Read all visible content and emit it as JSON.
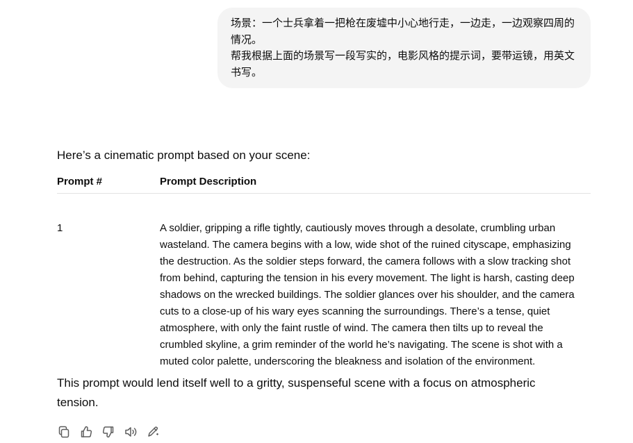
{
  "user_message": {
    "line1": "场景：一个士兵拿着一把枪在废墟中小心地行走，一边走，一边观察四周的情况。",
    "line2": "帮我根据上面的场景写一段写实的，电影风格的提示词，要带运镜，用英文书写。"
  },
  "assistant": {
    "intro": "Here’s a cinematic prompt based on your scene:",
    "table": {
      "headers": [
        "Prompt #",
        "Prompt Description"
      ],
      "rows": [
        {
          "number": "1",
          "description": "A soldier, gripping a rifle tightly, cautiously moves through a desolate, crumbling urban wasteland. The camera begins with a low, wide shot of the ruined cityscape, emphasizing the destruction. As the soldier steps forward, the camera follows with a slow tracking shot from behind, capturing the tension in his every movement. The light is harsh, casting deep shadows on the wrecked buildings. The soldier glances over his shoulder, and the camera cuts to a close-up of his wary eyes scanning the surroundings. There’s a tense, quiet atmosphere, with only the faint rustle of wind. The camera then tilts up to reveal the crumbled skyline, a grim reminder of the world he’s navigating. The scene is shot with a muted color palette, underscoring the bleakness and isolation of the environment."
        }
      ]
    },
    "outro": "This prompt would lend itself well to a gritty, suspenseful scene with a focus on atmospheric tension."
  },
  "actions": {
    "icons": [
      "copy-icon",
      "thumbs-up-icon",
      "thumbs-down-icon",
      "read-aloud-icon",
      "edit-icon"
    ]
  },
  "colors": {
    "bubble_bg": "#f4f4f4",
    "text": "#0d0d0d",
    "icon": "#5d5d5d",
    "divider": "#e3e3e3"
  }
}
